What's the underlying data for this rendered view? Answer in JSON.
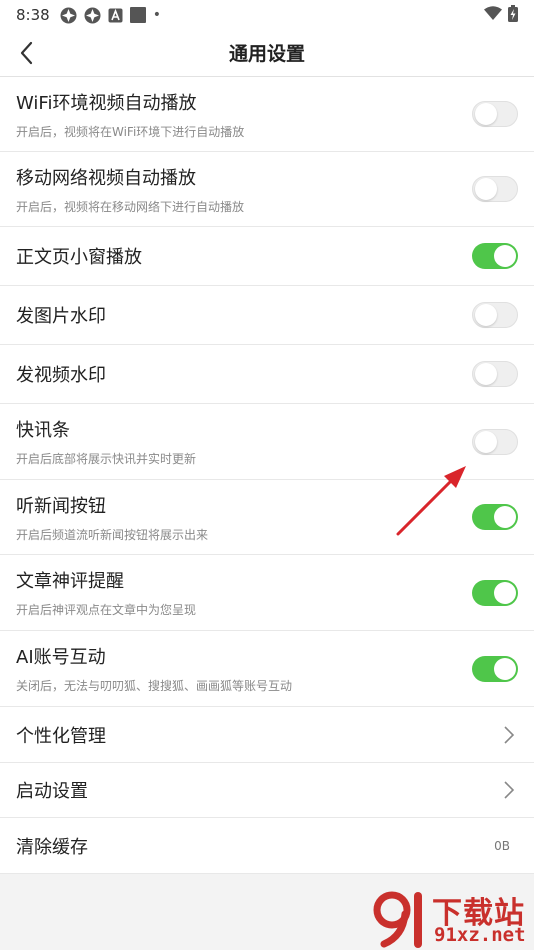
{
  "status_bar": {
    "time": "8:38",
    "dot": "•"
  },
  "header": {
    "title": "通用设置"
  },
  "settings": [
    {
      "title": "WiFi环境视频自动播放",
      "desc": "开启后，视频将在WiFi环境下进行自动播放",
      "on": false
    },
    {
      "title": "移动网络视频自动播放",
      "desc": "开启后，视频将在移动网络下进行自动播放",
      "on": false
    },
    {
      "title": "正文页小窗播放",
      "on": true
    },
    {
      "title": "发图片水印",
      "on": false
    },
    {
      "title": "发视频水印",
      "on": false
    },
    {
      "title": "快讯条",
      "desc": "开启后底部将展示快讯并实时更新",
      "on": false
    },
    {
      "title": "听新闻按钮",
      "desc": "开启后频道流听新闻按钮将展示出来",
      "on": true
    },
    {
      "title": "文章神评提醒",
      "desc": "开启后神评观点在文章中为您呈现",
      "on": true
    },
    {
      "title": "AI账号互动",
      "desc": "关闭后，无法与叨叨狐、搜搜狐、画画狐等账号互动",
      "on": true
    }
  ],
  "nav_items": [
    {
      "title": "个性化管理"
    },
    {
      "title": "启动设置"
    }
  ],
  "cache": {
    "title": "清除缓存",
    "value": "0B"
  },
  "watermark": {
    "line1": "下载站",
    "line2": "91xz.net"
  },
  "colors": {
    "toggle_on": "#4fc64a",
    "toggle_off": "#efefef",
    "annotation": "#d9252b",
    "watermark": "#c9302c"
  }
}
